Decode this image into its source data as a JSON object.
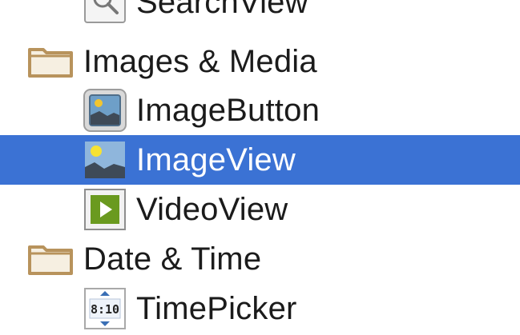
{
  "palette": {
    "items": [
      {
        "kind": "widget",
        "label": "SearchView",
        "icon": "search-icon"
      },
      {
        "kind": "category",
        "label": "Images & Media",
        "icon": "folder-icon"
      },
      {
        "kind": "widget",
        "label": "ImageButton",
        "icon": "image-button-icon"
      },
      {
        "kind": "widget",
        "label": "ImageView",
        "icon": "image-view-icon",
        "selected": true
      },
      {
        "kind": "widget",
        "label": "VideoView",
        "icon": "video-view-icon"
      },
      {
        "kind": "category",
        "label": "Date & Time",
        "icon": "folder-icon"
      },
      {
        "kind": "widget",
        "label": "TimePicker",
        "icon": "time-picker-icon",
        "icon_text": "8:10"
      }
    ],
    "colors": {
      "selection": "#3b72d4",
      "folder": "#c4a06a",
      "video_icon": "#6a9a1f"
    }
  }
}
